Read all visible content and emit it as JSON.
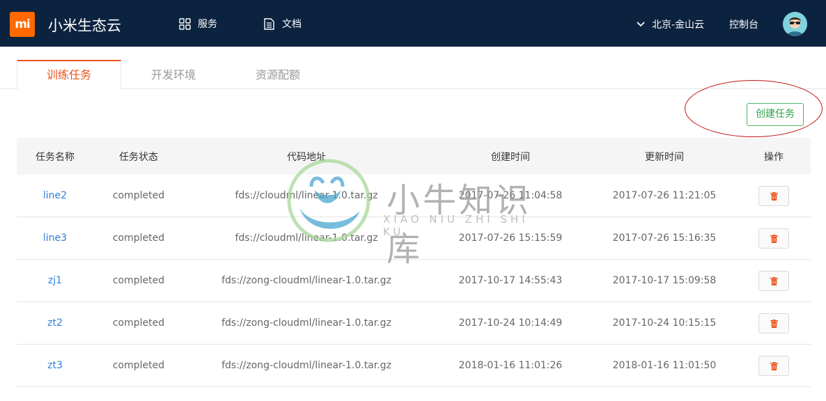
{
  "header": {
    "logo_text": "mi",
    "brand": "小米生态云",
    "nav": [
      {
        "label": "服务",
        "icon": "grid-icon"
      },
      {
        "label": "文档",
        "icon": "document-icon"
      }
    ],
    "region": "北京-金山云",
    "console": "控制台"
  },
  "tabs": [
    {
      "label": "训练任务",
      "active": true
    },
    {
      "label": "开发环境",
      "active": false
    },
    {
      "label": "资源配额",
      "active": false
    }
  ],
  "actions": {
    "create_label": "创建任务"
  },
  "table": {
    "columns": [
      "任务名称",
      "任务状态",
      "代码地址",
      "创建时间",
      "更新时间",
      "操作"
    ],
    "rows": [
      {
        "name": "line2",
        "status": "completed",
        "code": "fds://cloudml/linear-1.0.tar.gz",
        "created": "2017-07-26 11:04:58",
        "updated": "2017-07-26 11:21:05"
      },
      {
        "name": "line3",
        "status": "completed",
        "code": "fds://cloudml/linear-1.0.tar.gz",
        "created": "2017-07-26 15:15:59",
        "updated": "2017-07-26 15:16:35"
      },
      {
        "name": "zj1",
        "status": "completed",
        "code": "fds://zong-cloudml/linear-1.0.tar.gz",
        "created": "2017-10-17 14:55:43",
        "updated": "2017-10-17 15:09:58"
      },
      {
        "name": "zt2",
        "status": "completed",
        "code": "fds://zong-cloudml/linear-1.0.tar.gz",
        "created": "2017-10-24 10:14:49",
        "updated": "2017-10-24 10:15:15"
      },
      {
        "name": "zt3",
        "status": "completed",
        "code": "fds://zong-cloudml/linear-1.0.tar.gz",
        "created": "2018-01-16 11:01:26",
        "updated": "2018-01-16 11:01:50"
      }
    ]
  },
  "watermark": {
    "title": "小牛知识库",
    "subtitle": "XIAO NIU ZHI SHI KU"
  },
  "colors": {
    "topbar": "#0c2340",
    "brand_orange": "#ff6900",
    "active_tab": "#e8541e",
    "create_green": "#2ea24a",
    "link_blue": "#2f7fd8",
    "delete_red": "#e8541e",
    "annotation_red": "#c81010"
  }
}
